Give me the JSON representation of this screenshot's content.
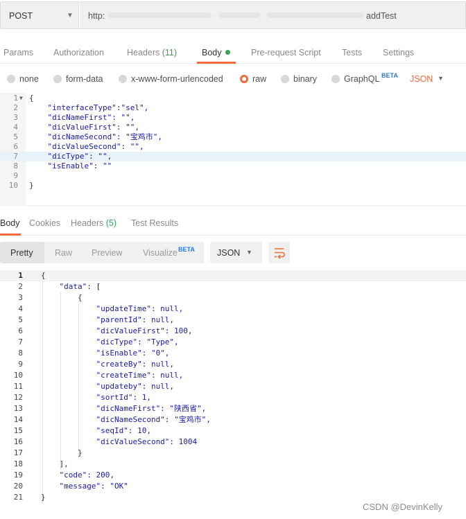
{
  "request": {
    "method": "POST",
    "url_prefix": "http:",
    "url_suffix": "addTest"
  },
  "request_tabs": [
    {
      "label": "Params"
    },
    {
      "label": "Authorization"
    },
    {
      "label": "Headers",
      "count": "(11)"
    },
    {
      "label": "Body",
      "active": true
    },
    {
      "label": "Pre-request Script"
    },
    {
      "label": "Tests"
    },
    {
      "label": "Settings"
    }
  ],
  "body_types": [
    {
      "label": "none"
    },
    {
      "label": "form-data"
    },
    {
      "label": "x-www-form-urlencoded"
    },
    {
      "label": "raw",
      "selected": true
    },
    {
      "label": "binary"
    },
    {
      "label": "GraphQL",
      "badge": "BETA"
    }
  ],
  "body_format": "JSON",
  "request_body": {
    "line_numbers": [
      "1",
      "2",
      "3",
      "4",
      "5",
      "6",
      "7",
      "8",
      "9",
      "10"
    ],
    "lines": [
      "{",
      "    \"interfaceType\":\"sel\",",
      "    \"dicNameFirst\": \"\",",
      "    \"dicValueFirst\": \"\",",
      "    \"dicNameSecond\": \"宝鸡市\",",
      "    \"dicValueSecond\": \"\",",
      "    \"dicType\": \"\",",
      "    \"isEnable\": \"\"",
      "",
      "}"
    ],
    "highlighted_line": 7
  },
  "response_tabs": [
    {
      "label": "Body",
      "active": true
    },
    {
      "label": "Cookies"
    },
    {
      "label": "Headers",
      "count": "(5)"
    },
    {
      "label": "Test Results"
    }
  ],
  "response_view": {
    "modes": [
      {
        "label": "Pretty",
        "active": true
      },
      {
        "label": "Raw"
      },
      {
        "label": "Preview"
      },
      {
        "label": "Visualize",
        "badge": "BETA"
      }
    ],
    "format": "JSON"
  },
  "response_body": {
    "line_numbers": [
      "1",
      "2",
      "3",
      "4",
      "5",
      "6",
      "7",
      "8",
      "9",
      "10",
      "11",
      "12",
      "13",
      "14",
      "15",
      "16",
      "17",
      "18",
      "19",
      "20",
      "21"
    ],
    "lines": [
      "{",
      "    \"data\": [",
      "        {",
      "            \"updateTime\": null,",
      "            \"parentId\": null,",
      "            \"dicValueFirst\": 100,",
      "            \"dicType\": \"Type\",",
      "            \"isEnable\": \"0\",",
      "            \"createBy\": null,",
      "            \"createTime\": null,",
      "            \"updateby\": null,",
      "            \"sortId\": 1,",
      "            \"dicNameFirst\": \"陕西省\",",
      "            \"dicNameSecond\": \"宝鸡市\",",
      "            \"seqId\": 10,",
      "            \"dicValueSecond\": 1004",
      "        }",
      "    ],",
      "    \"code\": 200,",
      "    \"message\": \"OK\"",
      "}"
    ]
  },
  "watermark": "CSDN @DevinKelly",
  "colors": {
    "accent": "#f26b3a",
    "count_green": "#3ba05c",
    "beta_blue": "#2a7ae2",
    "json_key": "#1a1aa6",
    "json_number": "#098658"
  }
}
